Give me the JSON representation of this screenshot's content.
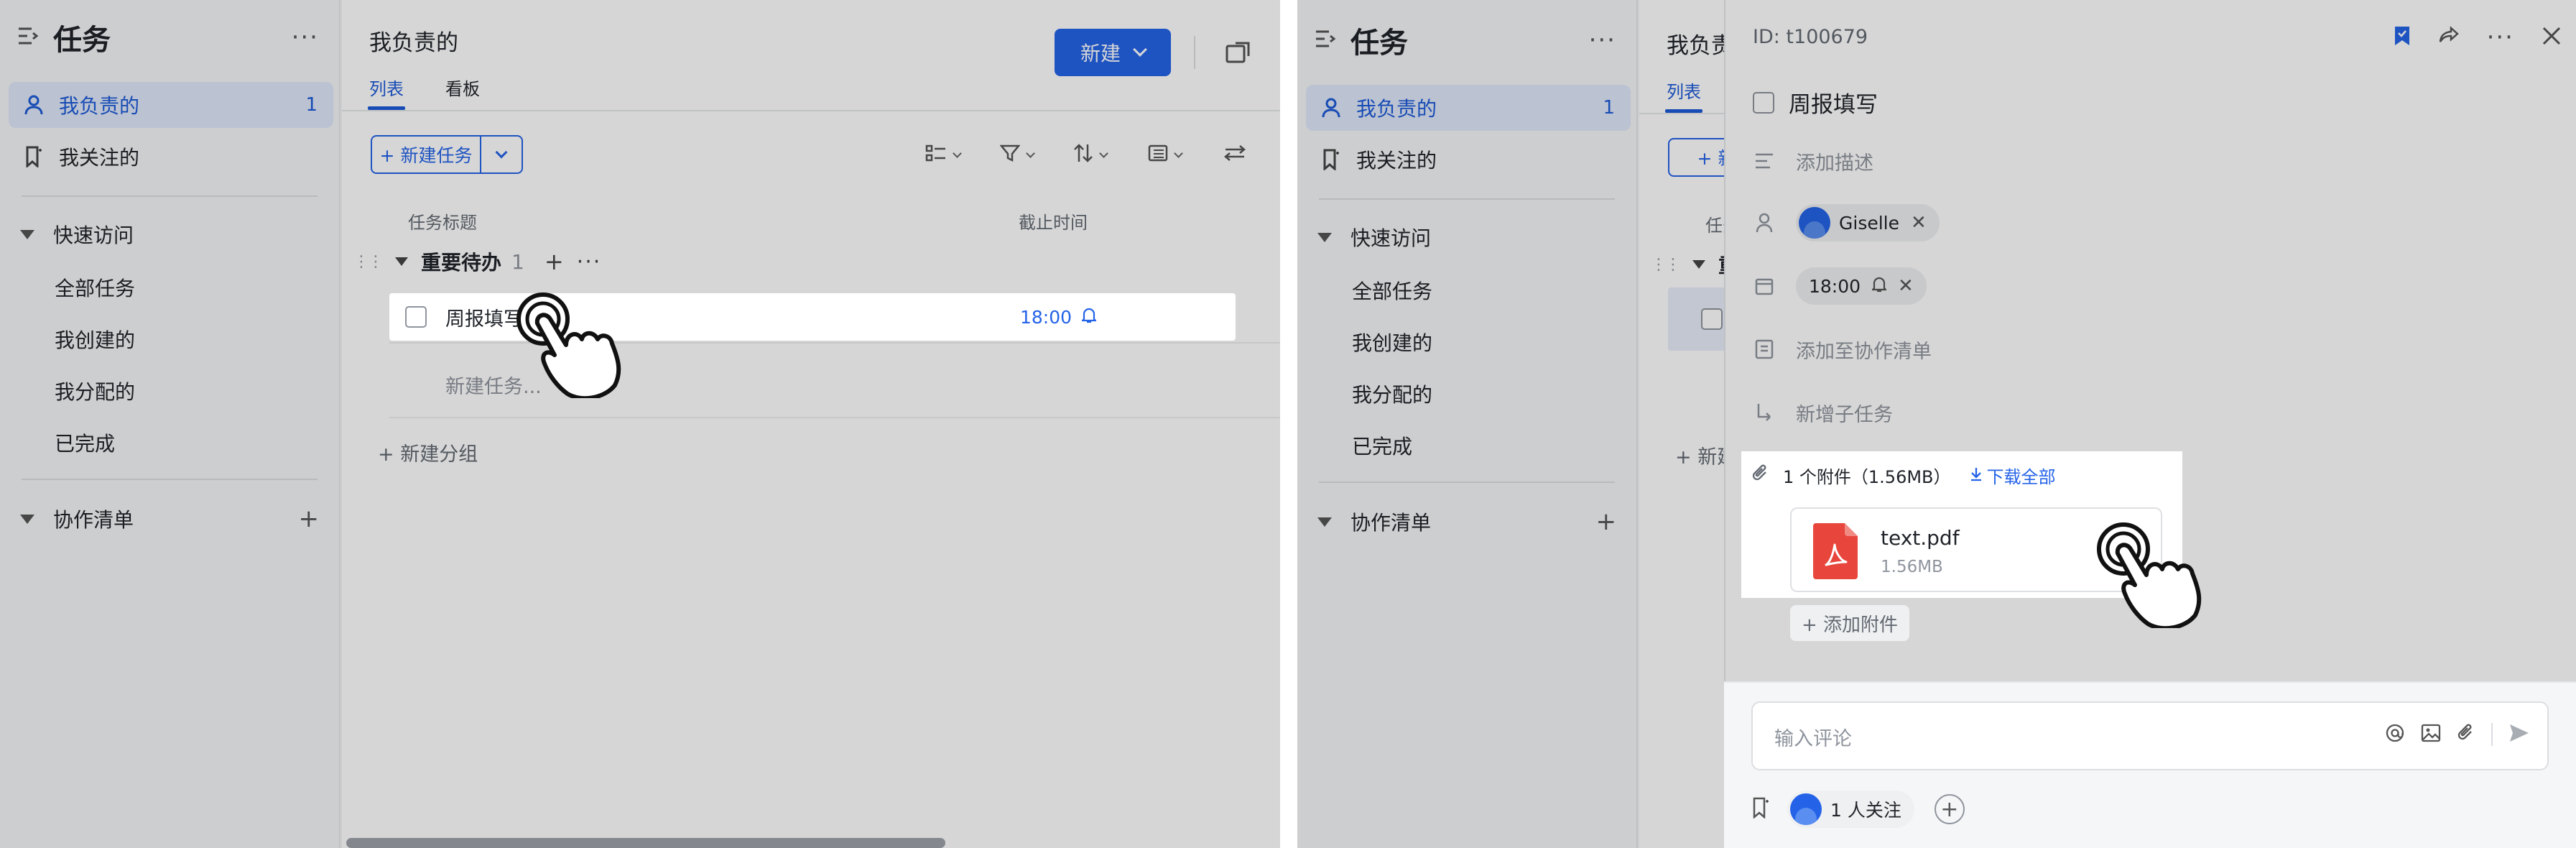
{
  "app": {
    "title": "任务",
    "more": "···"
  },
  "sidebar": {
    "items": [
      {
        "label": "我负责的",
        "count": "1"
      },
      {
        "label": "我关注的"
      }
    ],
    "quick_access": {
      "label": "快速访问",
      "items": [
        "全部任务",
        "我创建的",
        "我分配的",
        "已完成"
      ]
    },
    "collab": {
      "label": "协作清单",
      "plus": "+"
    }
  },
  "main": {
    "title": "我负责的",
    "tabs": [
      {
        "label": "列表",
        "active": true
      },
      {
        "label": "看板",
        "active": false
      }
    ],
    "new_button": "新建",
    "add_task_button": "+ 新建任务",
    "columns": {
      "title": "任务标题",
      "due": "截止时间"
    },
    "group": {
      "name": "重要待办",
      "count": "1",
      "plus": "+",
      "more": "···"
    },
    "task": {
      "title": "周报填写",
      "due": "18:00"
    },
    "new_task_placeholder": "新建任务...",
    "new_group": "+ 新建分组"
  },
  "detail": {
    "id": "ID: t100679",
    "title": "周报填写",
    "add_description": "添加描述",
    "assignee": "Giselle",
    "due": "18:00",
    "add_to_list": "添加至协作清单",
    "add_subtask": "新增子任务",
    "attachments": {
      "summary": "1 个附件（1.56MB）",
      "download_all": "下载全部",
      "file_name": "text.pdf",
      "file_size": "1.56MB",
      "add": "+ 添加附件"
    },
    "comment_placeholder": "输入评论",
    "followers": "1 人关注",
    "add_follower": "+"
  },
  "colors": {
    "accent": "#2463e8",
    "active_bg": "#dfe7fa",
    "pdf_red": "#e8453c"
  },
  "icons": [
    "list-toggle-icon",
    "user-icon",
    "bookmark-icon",
    "subtask-filter-icon",
    "filter-icon",
    "sort-icon",
    "view-icon",
    "settings-icon",
    "bell-icon",
    "calendar-icon",
    "pdf-icon",
    "download-icon",
    "paperclip-icon",
    "at-icon",
    "image-icon",
    "send-icon",
    "share-icon",
    "close-icon",
    "hand-pointer-icon"
  ]
}
